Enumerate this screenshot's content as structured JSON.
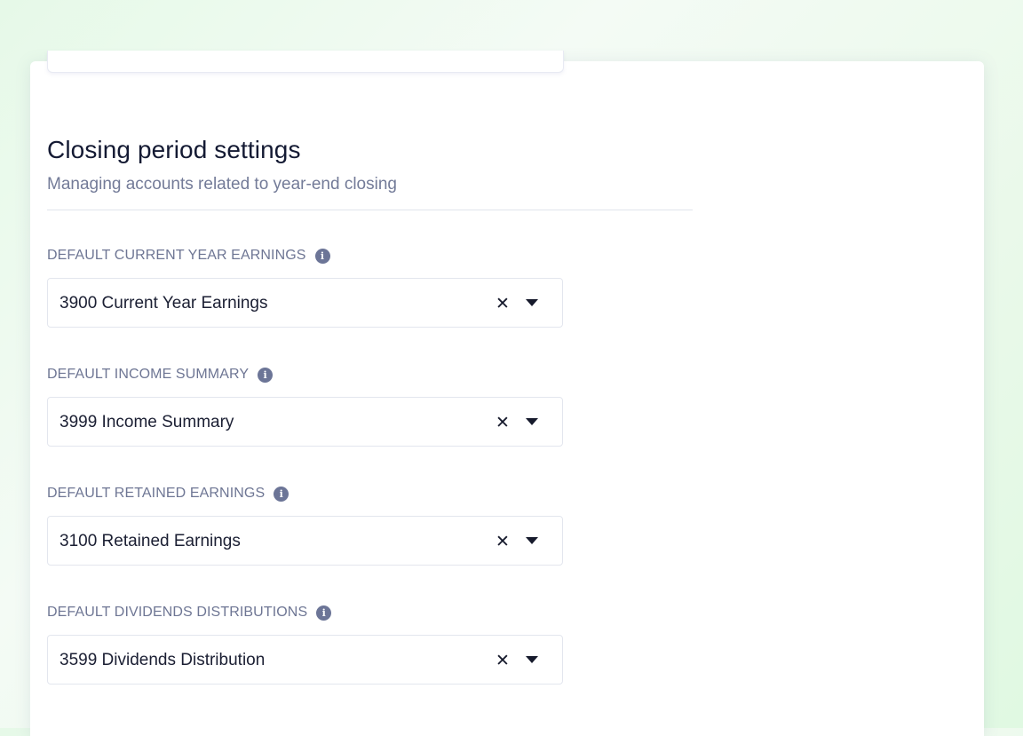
{
  "section": {
    "title": "Closing period settings",
    "subtitle": "Managing accounts related to year-end closing"
  },
  "fields": [
    {
      "label": "DEFAULT CURRENT YEAR EARNINGS",
      "value": "3900 Current Year Earnings",
      "info_icon": "info-icon",
      "clear_glyph": "✕"
    },
    {
      "label": "DEFAULT INCOME SUMMARY",
      "value": "3999 Income Summary",
      "info_icon": "info-icon",
      "clear_glyph": "✕"
    },
    {
      "label": "DEFAULT RETAINED EARNINGS",
      "value": "3100 Retained Earnings",
      "info_icon": "info-icon",
      "clear_glyph": "✕"
    },
    {
      "label": "DEFAULT DIVIDENDS DISTRIBUTIONS",
      "value": "3599 Dividends Distribution",
      "info_icon": "info-icon",
      "clear_glyph": "✕"
    }
  ],
  "info_glyph": "i",
  "colors": {
    "background": "#eaf9ea",
    "card": "#ffffff",
    "title": "#141a33",
    "muted": "#737b98",
    "border": "#e3e6ee"
  }
}
